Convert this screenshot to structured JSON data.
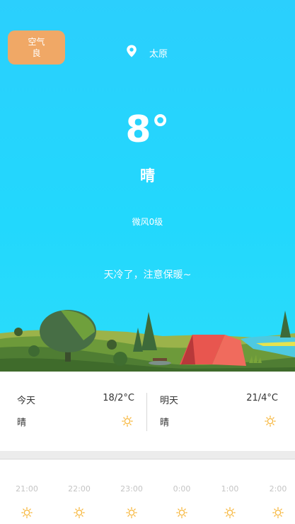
{
  "header": {
    "aqi_label": "空气",
    "aqi_value": "良",
    "location_icon": "location-pin-icon",
    "city": "太原"
  },
  "current": {
    "temperature": "8°",
    "condition": "晴",
    "wind": "微风0级",
    "tip": "天冷了，注意保暖~"
  },
  "forecast": [
    {
      "day": "今天",
      "range": "18/2°C",
      "condition": "晴",
      "icon": "sun-icon"
    },
    {
      "day": "明天",
      "range": "21/4°C",
      "condition": "晴",
      "icon": "sun-icon"
    }
  ],
  "hourly": [
    {
      "time": "21:00",
      "icon": "sun-icon"
    },
    {
      "time": "22:00",
      "icon": "sun-icon"
    },
    {
      "time": "23:00",
      "icon": "sun-icon"
    },
    {
      "time": "0:00",
      "icon": "sun-icon"
    },
    {
      "time": "1:00",
      "icon": "sun-icon"
    },
    {
      "time": "2:00",
      "icon": "sun-icon"
    }
  ],
  "colors": {
    "sky": "#22d8fd",
    "aqi_badge": "#f0a866",
    "sun_icon": "#f7b63b",
    "hour_text": "#c4c4c4"
  }
}
